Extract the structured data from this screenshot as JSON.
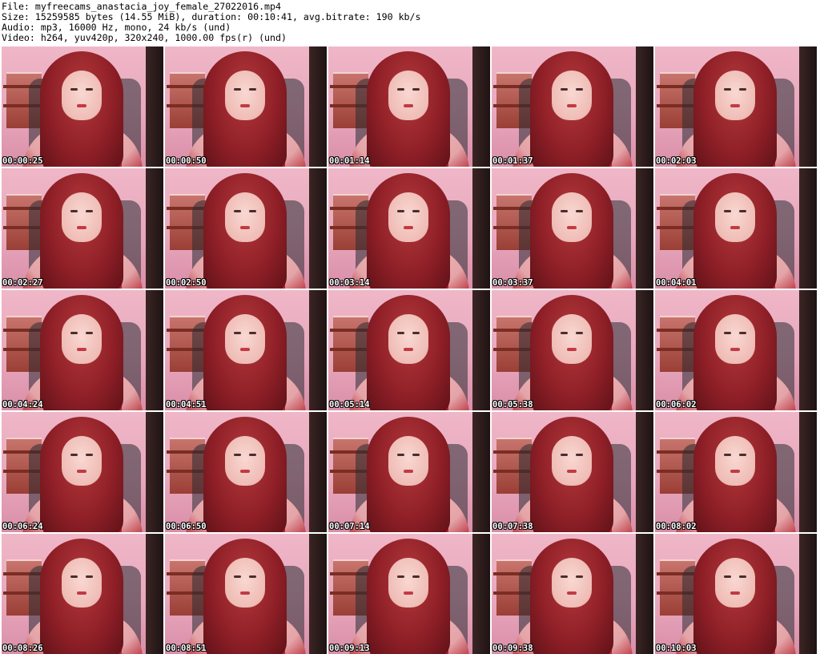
{
  "header": {
    "file_line": "File: myfreecams_anastacia_joy_female_27022016.mp4",
    "size_line": "Size: 15259585 bytes (14.55 MiB), duration: 00:10:41, avg.bitrate: 190 kb/s",
    "audio_line": "Audio: mp3, 16000 Hz, mono, 24 kb/s (und)",
    "video_line": "Video: h264, yuv420p, 320x240, 1000.00 fps(r) (und)"
  },
  "thumbnails": [
    {
      "timestamp": "00:00:25"
    },
    {
      "timestamp": "00:00:50"
    },
    {
      "timestamp": "00:01:14"
    },
    {
      "timestamp": "00:01:37"
    },
    {
      "timestamp": "00:02:03"
    },
    {
      "timestamp": "00:02:27"
    },
    {
      "timestamp": "00:02:50"
    },
    {
      "timestamp": "00:03:14"
    },
    {
      "timestamp": "00:03:37"
    },
    {
      "timestamp": "00:04:01"
    },
    {
      "timestamp": "00:04:24"
    },
    {
      "timestamp": "00:04:51"
    },
    {
      "timestamp": "00:05:14"
    },
    {
      "timestamp": "00:05:38"
    },
    {
      "timestamp": "00:06:02"
    },
    {
      "timestamp": "00:06:24"
    },
    {
      "timestamp": "00:06:50"
    },
    {
      "timestamp": "00:07:14"
    },
    {
      "timestamp": "00:07:38"
    },
    {
      "timestamp": "00:08:02"
    },
    {
      "timestamp": "00:08:26"
    },
    {
      "timestamp": "00:08:51"
    },
    {
      "timestamp": "00:09:13"
    },
    {
      "timestamp": "00:09:38"
    },
    {
      "timestamp": "00:10:03"
    }
  ]
}
